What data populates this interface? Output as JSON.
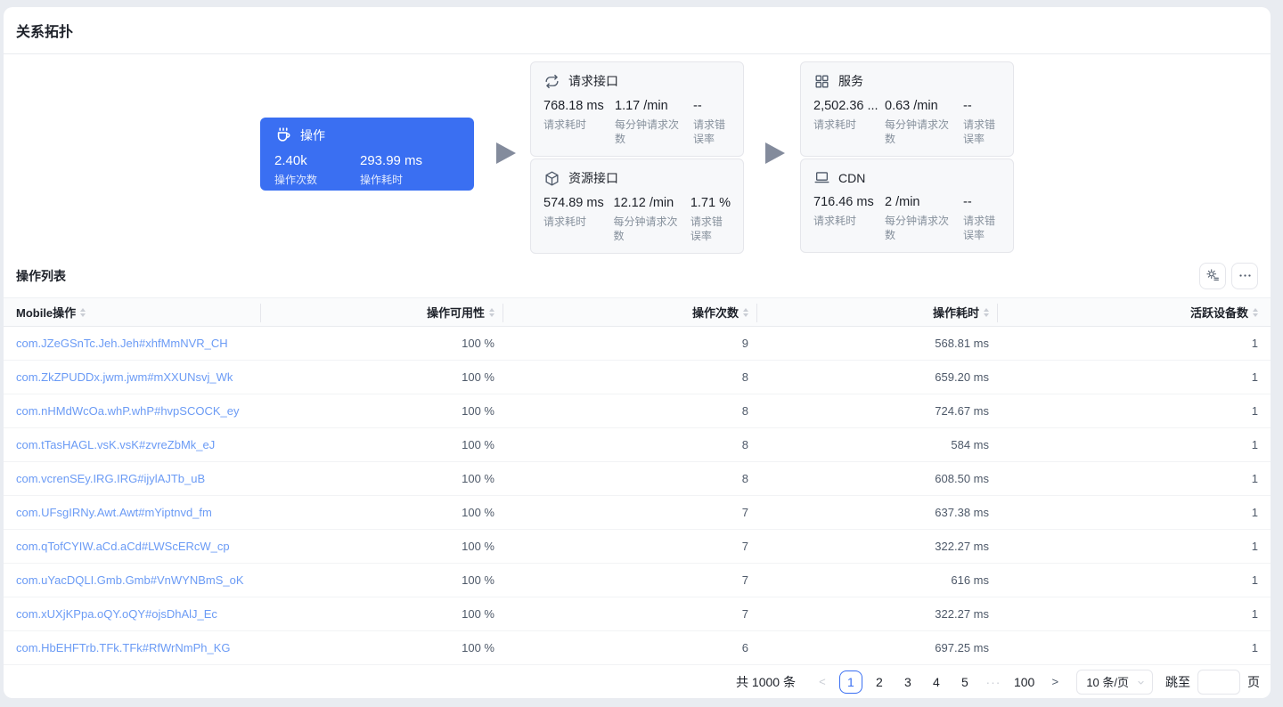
{
  "page": {
    "title": "关系拓扑"
  },
  "colors": {
    "accent": "#3a6ff2",
    "link": "#6b9bf5",
    "arrow": "#838b9c"
  },
  "topology": {
    "operation": {
      "icon": "cup-icon",
      "title": "操作",
      "metrics": [
        {
          "value": "2.40k",
          "label": "操作次数"
        },
        {
          "value": "293.99 ms",
          "label": "操作耗时"
        }
      ]
    },
    "request_api": {
      "icon": "loop-icon",
      "title": "请求接口",
      "metrics": [
        {
          "value": "768.18 ms",
          "label": "请求耗时"
        },
        {
          "value": "1.17 /min",
          "label": "每分钟请求次数"
        },
        {
          "value": "--",
          "label": "请求错误率"
        }
      ]
    },
    "resource_api": {
      "icon": "cube-icon",
      "title": "资源接口",
      "metrics": [
        {
          "value": "574.89 ms",
          "label": "请求耗时"
        },
        {
          "value": "12.12 /min",
          "label": "每分钟请求次数"
        },
        {
          "value": "1.71 %",
          "label": "请求错误率"
        }
      ]
    },
    "service": {
      "icon": "grid-icon",
      "title": "服务",
      "metrics": [
        {
          "value": "2,502.36 ...",
          "label": "请求耗时"
        },
        {
          "value": "0.63 /min",
          "label": "每分钟请求次数"
        },
        {
          "value": "--",
          "label": "请求错误率"
        }
      ]
    },
    "cdn": {
      "icon": "laptop-icon",
      "title": "CDN",
      "metrics": [
        {
          "value": "716.46 ms",
          "label": "请求耗时"
        },
        {
          "value": "2 /min",
          "label": "每分钟请求次数"
        },
        {
          "value": "--",
          "label": "请求错误率"
        }
      ]
    }
  },
  "operation_list": {
    "title": "操作列表",
    "toolbar_icons": [
      "gear-list-icon",
      "more-icon"
    ],
    "columns": [
      "Mobile操作",
      "操作可用性",
      "操作次数",
      "操作耗时",
      "活跃设备数"
    ],
    "rows": [
      {
        "name": "com.JZeGSnTc.Jeh.Jeh#xhfMmNVR_CH",
        "availability": "100 %",
        "count": "9",
        "duration": "568.81 ms",
        "devices": "1"
      },
      {
        "name": "com.ZkZPUDDx.jwm.jwm#mXXUNsvj_Wk",
        "availability": "100 %",
        "count": "8",
        "duration": "659.20 ms",
        "devices": "1"
      },
      {
        "name": "com.nHMdWcOa.whP.whP#hvpSCOCK_ey",
        "availability": "100 %",
        "count": "8",
        "duration": "724.67 ms",
        "devices": "1"
      },
      {
        "name": "com.tTasHAGL.vsK.vsK#zvreZbMk_eJ",
        "availability": "100 %",
        "count": "8",
        "duration": "584 ms",
        "devices": "1"
      },
      {
        "name": "com.vcrenSEy.IRG.IRG#ijylAJTb_uB",
        "availability": "100 %",
        "count": "8",
        "duration": "608.50 ms",
        "devices": "1"
      },
      {
        "name": "com.UFsgIRNy.Awt.Awt#mYiptnvd_fm",
        "availability": "100 %",
        "count": "7",
        "duration": "637.38 ms",
        "devices": "1"
      },
      {
        "name": "com.qTofCYIW.aCd.aCd#LWScERcW_cp",
        "availability": "100 %",
        "count": "7",
        "duration": "322.27 ms",
        "devices": "1"
      },
      {
        "name": "com.uYacDQLI.Gmb.Gmb#VnWYNBmS_oK",
        "availability": "100 %",
        "count": "7",
        "duration": "616 ms",
        "devices": "1"
      },
      {
        "name": "com.xUXjKPpa.oQY.oQY#ojsDhAlJ_Ec",
        "availability": "100 %",
        "count": "7",
        "duration": "322.27 ms",
        "devices": "1"
      },
      {
        "name": "com.HbEHFTrb.TFk.TFk#RfWrNmPh_KG",
        "availability": "100 %",
        "count": "6",
        "duration": "697.25 ms",
        "devices": "1"
      }
    ],
    "pagination": {
      "total": "共 1000 条",
      "prev": "<",
      "next": ">",
      "pages": [
        "1",
        "2",
        "3",
        "4",
        "5"
      ],
      "current_page": "1",
      "ellipsis": "···",
      "last_page": "100",
      "page_size": "10 条/页",
      "jump_label": "跳至",
      "page_unit": "页"
    }
  }
}
